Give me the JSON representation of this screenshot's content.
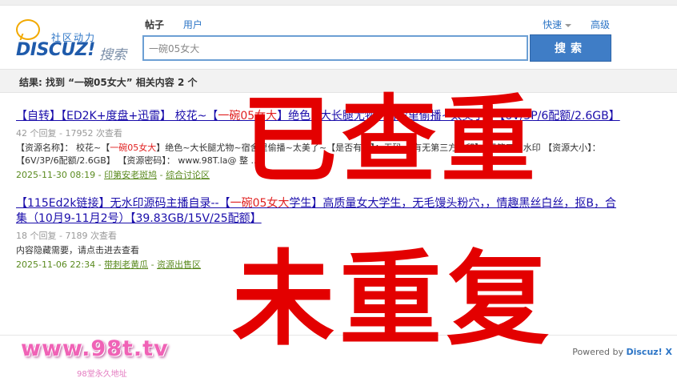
{
  "logo": {
    "slogan": "社区动力",
    "brand": "DISCUZ!",
    "search_word": "搜索"
  },
  "tabs": [
    {
      "label": "帖子"
    },
    {
      "label": "用户"
    }
  ],
  "right_links": {
    "quick": "快速",
    "advanced": "高级"
  },
  "search": {
    "value": "一碗05女大",
    "button": "搜索"
  },
  "result_summary": "结果: 找到 “一碗05女大” 相关内容 2 个",
  "results": [
    {
      "title_prefix": "【自转】【ED2K+度盘+迅雷】 校花~【",
      "title_hl": "一碗05女大",
      "title_suffix": "】绝色~大长腿尤物~宿舍里偷播~太美了~【6V/3P/6配额/2.6GB】",
      "meta": "42 个回复 - 17952 次查看",
      "snip_a": "【资源名称】： 校花~【",
      "snip_hl": "一碗05女大",
      "snip_b": "】绝色~大长腿尤物~宿舍里偷播~太美了~【是否有码】：无码 【有无第三方水印】：无第三方水印 【资源大小】： 【6V/3P/6配额/2.6GB】 【资源密码】： www.98T.la@ 整 ...",
      "date": "2025-11-30 08:19",
      "author": "印第安老斑鸠",
      "forum": "综合讨论区"
    },
    {
      "title_prefix": "【115Ed2k链接】无水印源码主播自录--【",
      "title_hl": "一碗05女大",
      "title_suffix": "学生】高质量女大学生，无毛馒头粉穴，，情趣黑丝白丝，抠B，合集（10月9-11月2号）【39.83GB/15V/25配额】",
      "meta": "18 个回复 - 7189 次查看",
      "snip": "内容隐藏需要，请点击进去查看",
      "date": "2025-11-06 22:34",
      "author": "带刺老黄瓜",
      "forum": "资源出售区"
    }
  ],
  "footer": {
    "powered_prefix": "Powered by ",
    "powered_brand": "Discuz! X"
  },
  "watermark": {
    "url": "www.98t.tv",
    "sub": "98堂永久地址"
  },
  "stamps": {
    "checked": "已查重",
    "not_duplicate": "未重复"
  },
  "colors": {
    "accent": "#3f7dc6",
    "stamp": "#e30000",
    "link": "#1a0dab",
    "highlight": "#e02020"
  }
}
